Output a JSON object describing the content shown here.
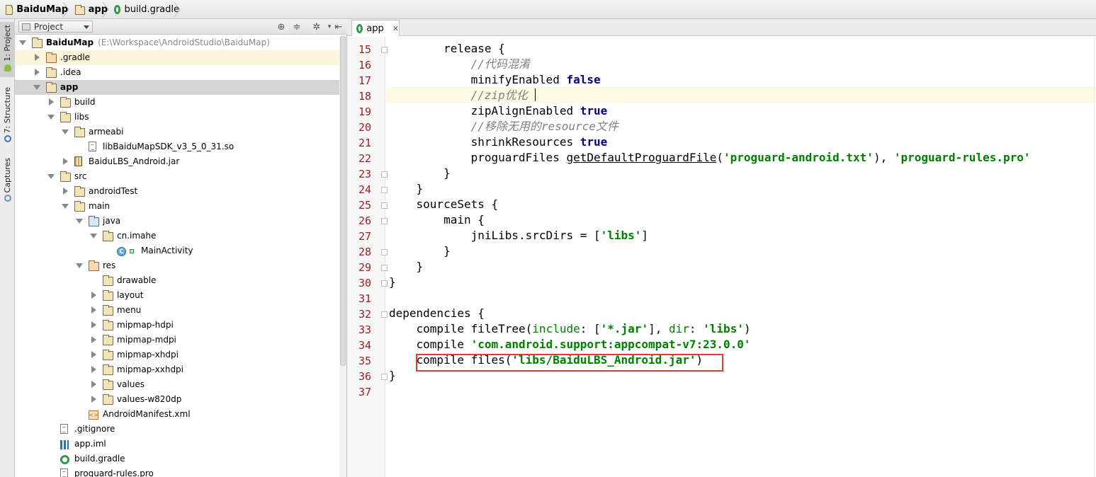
{
  "breadcrumb": [
    {
      "label": "BaiduMap",
      "icon": "module-folder-icon"
    },
    {
      "label": "app",
      "icon": "module-folder-icon"
    },
    {
      "label": "build.gradle",
      "icon": "gradle-icon"
    }
  ],
  "toolstrip": {
    "tabs": [
      "1: Project",
      "7: Structure",
      "Captures"
    ]
  },
  "project_panel": {
    "view": "Project",
    "tree": [
      {
        "label": "BaiduMap",
        "path": "(E:\\Workspace\\AndroidStudio\\BaiduMap)",
        "icon": "module",
        "arrow": "down",
        "level": 0,
        "bold": true
      },
      {
        "label": ".gradle",
        "icon": "folder-orange",
        "arrow": "right",
        "level": 1
      },
      {
        "label": ".idea",
        "icon": "folder",
        "arrow": "right",
        "level": 1
      },
      {
        "label": "app",
        "icon": "module",
        "arrow": "down",
        "level": 1,
        "bold": true
      },
      {
        "label": "build",
        "icon": "folder",
        "arrow": "right",
        "level": 2
      },
      {
        "label": "libs",
        "icon": "folder",
        "arrow": "down",
        "level": 2
      },
      {
        "label": "armeabi",
        "icon": "folder",
        "arrow": "down",
        "level": 3
      },
      {
        "label": "libBaiduMapSDK_v3_5_0_31.so",
        "icon": "file",
        "arrow": "",
        "level": 4
      },
      {
        "label": "BaiduLBS_Android.jar",
        "icon": "jar",
        "arrow": "right",
        "level": 3
      },
      {
        "label": "src",
        "icon": "folder",
        "arrow": "down",
        "level": 2
      },
      {
        "label": "androidTest",
        "icon": "folder",
        "arrow": "right",
        "level": 3
      },
      {
        "label": "main",
        "icon": "folder",
        "arrow": "down",
        "level": 3
      },
      {
        "label": "java",
        "icon": "folder-blue",
        "arrow": "down",
        "level": 4
      },
      {
        "label": "cn.imahe",
        "icon": "folder",
        "arrow": "down",
        "level": 5
      },
      {
        "label": "MainActivity",
        "icon": "class",
        "arrow": "",
        "level": 6
      },
      {
        "label": "res",
        "icon": "folder-res",
        "arrow": "down",
        "level": 4
      },
      {
        "label": "drawable",
        "icon": "folder",
        "arrow": "",
        "level": 5
      },
      {
        "label": "layout",
        "icon": "folder",
        "arrow": "right",
        "level": 5
      },
      {
        "label": "menu",
        "icon": "folder",
        "arrow": "right",
        "level": 5
      },
      {
        "label": "mipmap-hdpi",
        "icon": "folder",
        "arrow": "right",
        "level": 5
      },
      {
        "label": "mipmap-mdpi",
        "icon": "folder",
        "arrow": "right",
        "level": 5
      },
      {
        "label": "mipmap-xhdpi",
        "icon": "folder",
        "arrow": "right",
        "level": 5
      },
      {
        "label": "mipmap-xxhdpi",
        "icon": "folder",
        "arrow": "right",
        "level": 5
      },
      {
        "label": "values",
        "icon": "folder",
        "arrow": "right",
        "level": 5
      },
      {
        "label": "values-w820dp",
        "icon": "folder",
        "arrow": "right",
        "level": 5
      },
      {
        "label": "AndroidManifest.xml",
        "icon": "xml",
        "arrow": "",
        "level": 4
      },
      {
        "label": ".gitignore",
        "icon": "file",
        "arrow": "",
        "level": 2
      },
      {
        "label": "app.iml",
        "icon": "iml",
        "arrow": "",
        "level": 2
      },
      {
        "label": "build.gradle",
        "icon": "gradle",
        "arrow": "",
        "level": 2
      },
      {
        "label": "proguard-rules.pro",
        "icon": "file",
        "arrow": "",
        "level": 2
      }
    ]
  },
  "editor": {
    "tab_label": "app",
    "lines": [
      {
        "n": "15",
        "tokens": [
          [
            "ident",
            "        release {"
          ]
        ]
      },
      {
        "n": "16",
        "tokens": [
          [
            "cmt",
            "            //代码混淆"
          ]
        ]
      },
      {
        "n": "17",
        "tokens": [
          [
            "ident",
            "            minifyEnabled "
          ],
          [
            "kw",
            "false"
          ]
        ]
      },
      {
        "n": "18",
        "tokens": [
          [
            "cmt",
            "            //zip优化"
          ]
        ]
      },
      {
        "n": "19",
        "tokens": [
          [
            "ident",
            "            zipAlignEnabled "
          ],
          [
            "kw",
            "true"
          ]
        ]
      },
      {
        "n": "20",
        "tokens": [
          [
            "cmt",
            "            //移除无用的resource文件"
          ]
        ]
      },
      {
        "n": "21",
        "tokens": [
          [
            "ident",
            "            shrinkResources "
          ],
          [
            "kw",
            "true"
          ]
        ]
      },
      {
        "n": "22",
        "tokens": [
          [
            "ident",
            "            proguardFiles "
          ],
          [
            "fn",
            "getDefaultProguardFile"
          ],
          [
            "ident",
            "("
          ],
          [
            "str",
            "'proguard-android.txt'"
          ],
          [
            "ident",
            "), "
          ],
          [
            "str",
            "'proguard-rules.pro'"
          ]
        ]
      },
      {
        "n": "23",
        "tokens": [
          [
            "ident",
            "        }"
          ]
        ]
      },
      {
        "n": "24",
        "tokens": [
          [
            "ident",
            "    }"
          ]
        ]
      },
      {
        "n": "25",
        "tokens": [
          [
            "ident",
            "    sourceSets {"
          ]
        ]
      },
      {
        "n": "26",
        "tokens": [
          [
            "ident",
            "        main {"
          ]
        ]
      },
      {
        "n": "27",
        "tokens": [
          [
            "ident",
            "            jniLibs.srcDirs = ["
          ],
          [
            "str",
            "'libs'"
          ],
          [
            "ident",
            "]"
          ]
        ]
      },
      {
        "n": "28",
        "tokens": [
          [
            "ident",
            "        }"
          ]
        ]
      },
      {
        "n": "29",
        "tokens": [
          [
            "ident",
            "    }"
          ]
        ]
      },
      {
        "n": "30",
        "tokens": [
          [
            "ident",
            "}"
          ]
        ]
      },
      {
        "n": "31",
        "tokens": []
      },
      {
        "n": "32",
        "tokens": [
          [
            "ident",
            "dependencies {"
          ]
        ]
      },
      {
        "n": "33",
        "tokens": [
          [
            "ident",
            "    compile fileTree("
          ],
          [
            "strlbl",
            "include"
          ],
          [
            "ident",
            ": ["
          ],
          [
            "str",
            "'*.jar'"
          ],
          [
            "ident",
            "], "
          ],
          [
            "strlbl",
            "dir"
          ],
          [
            "ident",
            ": "
          ],
          [
            "str",
            "'libs'"
          ],
          [
            "ident",
            ")"
          ]
        ]
      },
      {
        "n": "34",
        "tokens": [
          [
            "ident",
            "    compile "
          ],
          [
            "str",
            "'com.android.support:appcompat-v7:23.0.0'"
          ]
        ]
      },
      {
        "n": "35",
        "tokens": [
          [
            "ident",
            "    compile files("
          ],
          [
            "str",
            "'libs/BaiduLBS_Android.jar'"
          ],
          [
            "ident",
            ")"
          ]
        ]
      },
      {
        "n": "36",
        "tokens": [
          [
            "ident",
            "}"
          ]
        ]
      },
      {
        "n": "37",
        "tokens": []
      }
    ]
  },
  "colors": {
    "line_number": "#9b1d1d",
    "keyword": "#000080",
    "string": "#008000",
    "comment": "#808080",
    "highlight_box": "#e53935"
  }
}
